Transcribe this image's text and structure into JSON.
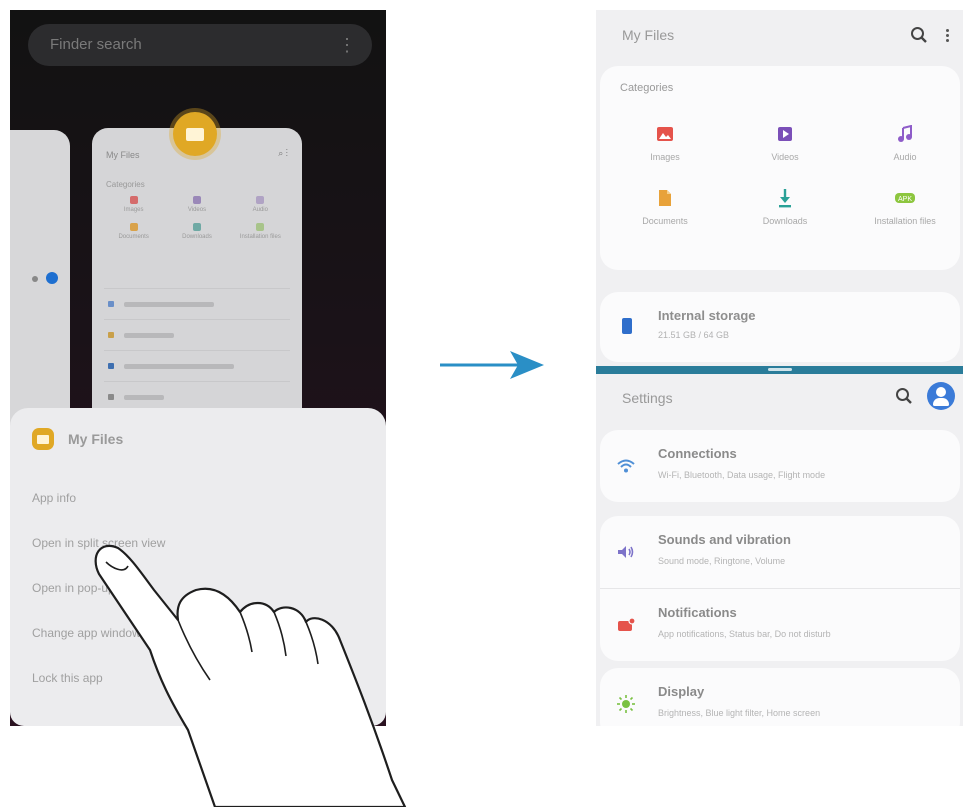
{
  "left_phone": {
    "search_placeholder": "Finder search",
    "recent_card_title": "My Files",
    "recent_card_categories_label": "Categories",
    "recent_card_categories": [
      "Images",
      "Videos",
      "Audio",
      "Documents",
      "Downloads",
      "Installation files"
    ],
    "popup": {
      "app_name": "My Files",
      "menu_items": [
        "App info",
        "Open in split screen view",
        "Open in pop-up view",
        "Change app window",
        "Lock this app"
      ]
    }
  },
  "right_phone": {
    "top_app": {
      "title": "My Files",
      "categories_label": "Categories",
      "categories": [
        {
          "label": "Images",
          "icon": "image-icon",
          "color": "#e5534b"
        },
        {
          "label": "Videos",
          "icon": "video-icon",
          "color": "#7b4fb8"
        },
        {
          "label": "Audio",
          "icon": "music-note-icon",
          "color": "#8e5cc9"
        },
        {
          "label": "Documents",
          "icon": "document-icon",
          "color": "#e8a23a"
        },
        {
          "label": "Downloads",
          "icon": "download-icon",
          "color": "#2aa197"
        },
        {
          "label": "Installation files",
          "icon": "apk-icon",
          "color": "#8dc63f"
        }
      ],
      "storage": {
        "name": "Internal storage",
        "detail": "21.51 GB / 64 GB"
      }
    },
    "bottom_app": {
      "title": "Settings",
      "items": [
        {
          "title": "Connections",
          "subtitle": "Wi-Fi, Bluetooth, Data usage, Flight mode",
          "icon": "wifi-icon",
          "color": "#4f8fd6"
        },
        {
          "title": "Sounds and vibration",
          "subtitle": "Sound mode, Ringtone, Volume",
          "icon": "speaker-icon",
          "color": "#7d73c9"
        },
        {
          "title": "Notifications",
          "subtitle": "App notifications, Status bar, Do not disturb",
          "icon": "notification-icon",
          "color": "#e5534b"
        },
        {
          "title": "Display",
          "subtitle": "Brightness, Blue light filter, Home screen",
          "icon": "sun-icon",
          "color": "#7ac143"
        }
      ]
    }
  },
  "colors": {
    "arrow": "#2a8fc6",
    "app_badge": "#e0a825",
    "split_divider": "#2a7c9a"
  }
}
